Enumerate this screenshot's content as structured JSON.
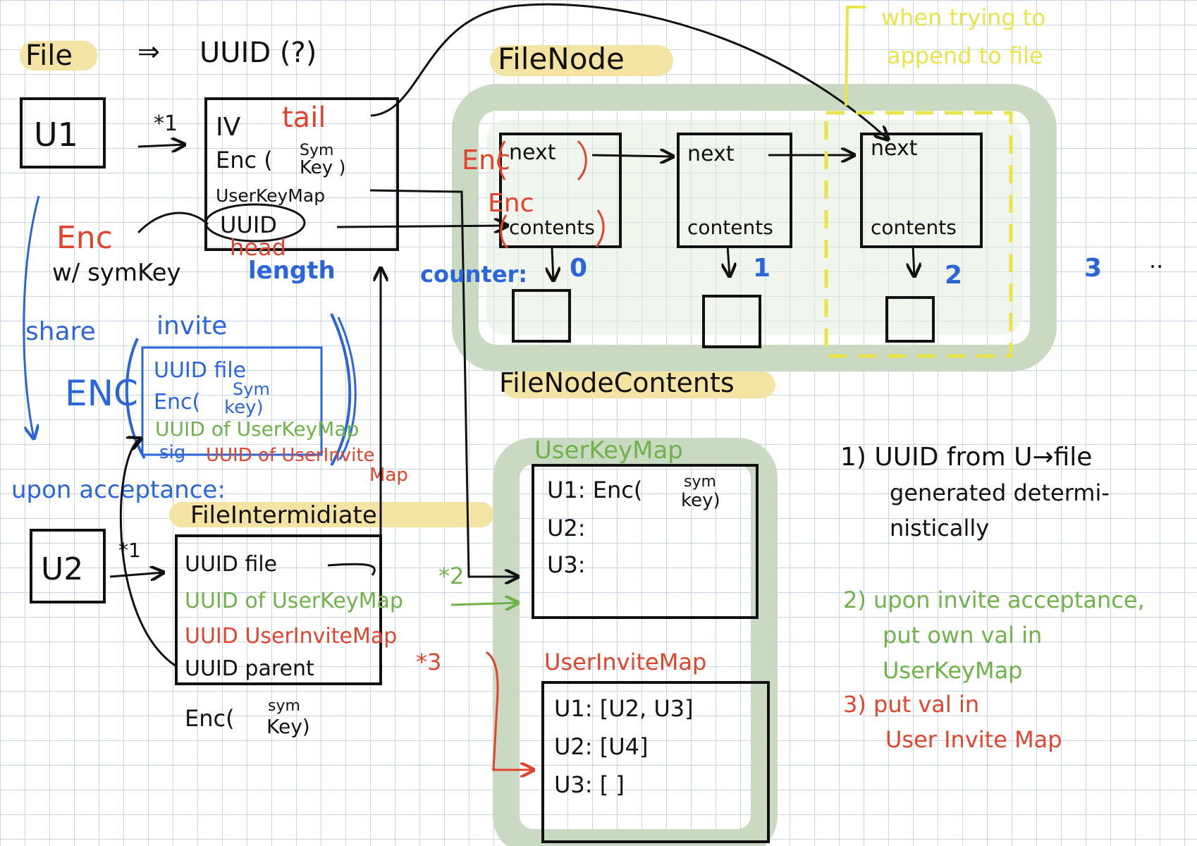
{
  "colors": {
    "ink": "#111111",
    "red": "#e0442c",
    "blue": "#2a66d8",
    "green": "#6fb24a",
    "yellow": "#e9e44a",
    "highlight": "#f4e4a4",
    "region": "#c9d9c2",
    "grid": "#c9d3e6"
  },
  "header": {
    "file": "File",
    "arrow": "⇒",
    "uuid": "UUID (?)"
  },
  "u1": {
    "label": "U1",
    "mark": "*1"
  },
  "file_struct": {
    "iv": "IV",
    "tail": "tail",
    "enc": "Enc (",
    "sym": "Sym",
    "key": "Key )",
    "user_key_map": "UserKeyMap",
    "uuid": "UUID",
    "head": "head",
    "length": "length"
  },
  "enc_note": {
    "enc": "Enc",
    "with": "w/ symKey"
  },
  "share": {
    "share": "share",
    "invite": "invite",
    "enc": "ENC"
  },
  "invite_box": {
    "line1": "UUID file",
    "enc": "Enc(",
    "sym": "Sym",
    "key": "key)",
    "line3": "UUID of UserKeyMap",
    "sig": "sig",
    "line4": "UUID of UserInvite",
    "line4b": "Map"
  },
  "upon_acceptance": "upon acceptance:",
  "file_intermediate": {
    "title": "FileIntermidiate",
    "uuid_file": "UUID file",
    "uuid_ukm": "UUID of UserKeyMap",
    "uuid_uim": "UUID UserInviteMap",
    "uuid_parent": "UUID parent",
    "enc": "Enc(",
    "sym": "sym",
    "key": "Key)"
  },
  "u2": {
    "label": "U2",
    "mark": "*1"
  },
  "marks": {
    "m2": "*2",
    "m3": "*3"
  },
  "filenode": {
    "title": "FileNode",
    "enc": "Enc",
    "enc2": "Enc",
    "next": "next",
    "contents": "contents",
    "counter": "counter:",
    "idx": [
      "0",
      "1",
      "2",
      "3"
    ],
    "dots": "..",
    "contents_title": "FileNodeContents"
  },
  "yellow_note": {
    "line1": "when trying to",
    "line2": "append to file"
  },
  "user_key_map": {
    "title": "UserKeyMap",
    "rows": [
      "U1: Enc(",
      "U2:",
      "U3:"
    ],
    "sym": "sym",
    "key": "key)"
  },
  "user_invite_map": {
    "title": "UserInviteMap",
    "rows": [
      "U1: [U2, U3]",
      "U2: [U4]",
      "U3: [      ]"
    ]
  },
  "notes": {
    "n1": [
      "1) UUID  from U→file",
      "generated determi-",
      "nistically"
    ],
    "n2": [
      "2) upon invite acceptance,",
      "put own val in",
      "UserKeyMap"
    ],
    "n3": [
      "3) put val in",
      "User Invite Map"
    ]
  }
}
